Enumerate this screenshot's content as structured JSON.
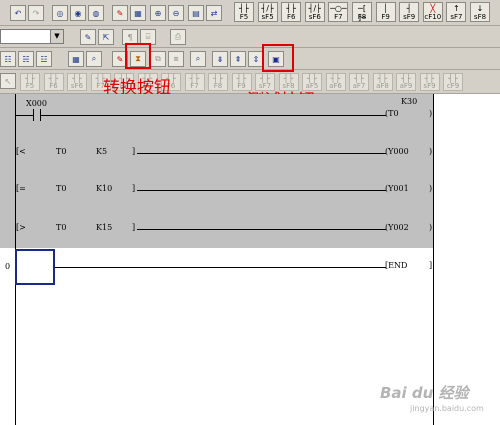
{
  "toolbar_top": {
    "fkeys": [
      {
        "sym": "┤├",
        "label": "F5"
      },
      {
        "sym": "┤/├",
        "label": "sF5"
      },
      {
        "sym": "┤├",
        "label": "F6"
      },
      {
        "sym": "┤/├",
        "label": "sF6"
      },
      {
        "sym": "─○─",
        "label": "F7"
      },
      {
        "sym": "─[ ]─",
        "label": "F8"
      },
      {
        "sym": "│",
        "label": "F9"
      },
      {
        "sym": "┤",
        "label": "sF9"
      },
      {
        "sym": "╳",
        "label": "cF10"
      },
      {
        "sym": "↑",
        "label": "sF7"
      },
      {
        "sym": "↓",
        "label": "sF8"
      }
    ]
  },
  "toolbar_second": {
    "dropdown_value": ""
  },
  "toolbar_third": {
    "fkeys": [
      "F5",
      "F6",
      "sF6",
      "F7",
      "F8",
      "F9",
      "F6",
      "F7",
      "F8",
      "F9",
      "sF7",
      "sF8",
      "aF5",
      "aF6",
      "aF7",
      "aF8",
      "aF9",
      "sF9",
      "cF9"
    ]
  },
  "annotations": {
    "convert_button": "转换按钮",
    "test_button": "测试按钮"
  },
  "ladder": {
    "rungs": [
      {
        "step": "",
        "contact": "X000",
        "coil_device": "K30",
        "coil_label": "(T0"
      },
      {
        "step": "",
        "compare_op": "[<",
        "operand1": "T0",
        "operand2": "K5",
        "coil_label": "(Y000"
      },
      {
        "step": "",
        "compare_op": "[=",
        "operand1": "T0",
        "operand2": "K10",
        "coil_label": "(Y001"
      },
      {
        "step": "",
        "compare_op": "[>",
        "operand1": "T0",
        "operand2": "K15",
        "coil_label": "(Y002"
      },
      {
        "step": "0",
        "coil_label": "[END"
      }
    ],
    "rung_end_marks": [
      ")",
      ")",
      ")",
      ")",
      "]"
    ]
  },
  "watermark": {
    "brand": "Bai du 经验",
    "url": "jingyan.baidu.com"
  },
  "colors": {
    "toolbar_bg": "#d4d0c8",
    "ladder_bg": "#c0c0c0",
    "annotation_red": "#e00000",
    "cursor_blue": "#1a2a8a"
  }
}
